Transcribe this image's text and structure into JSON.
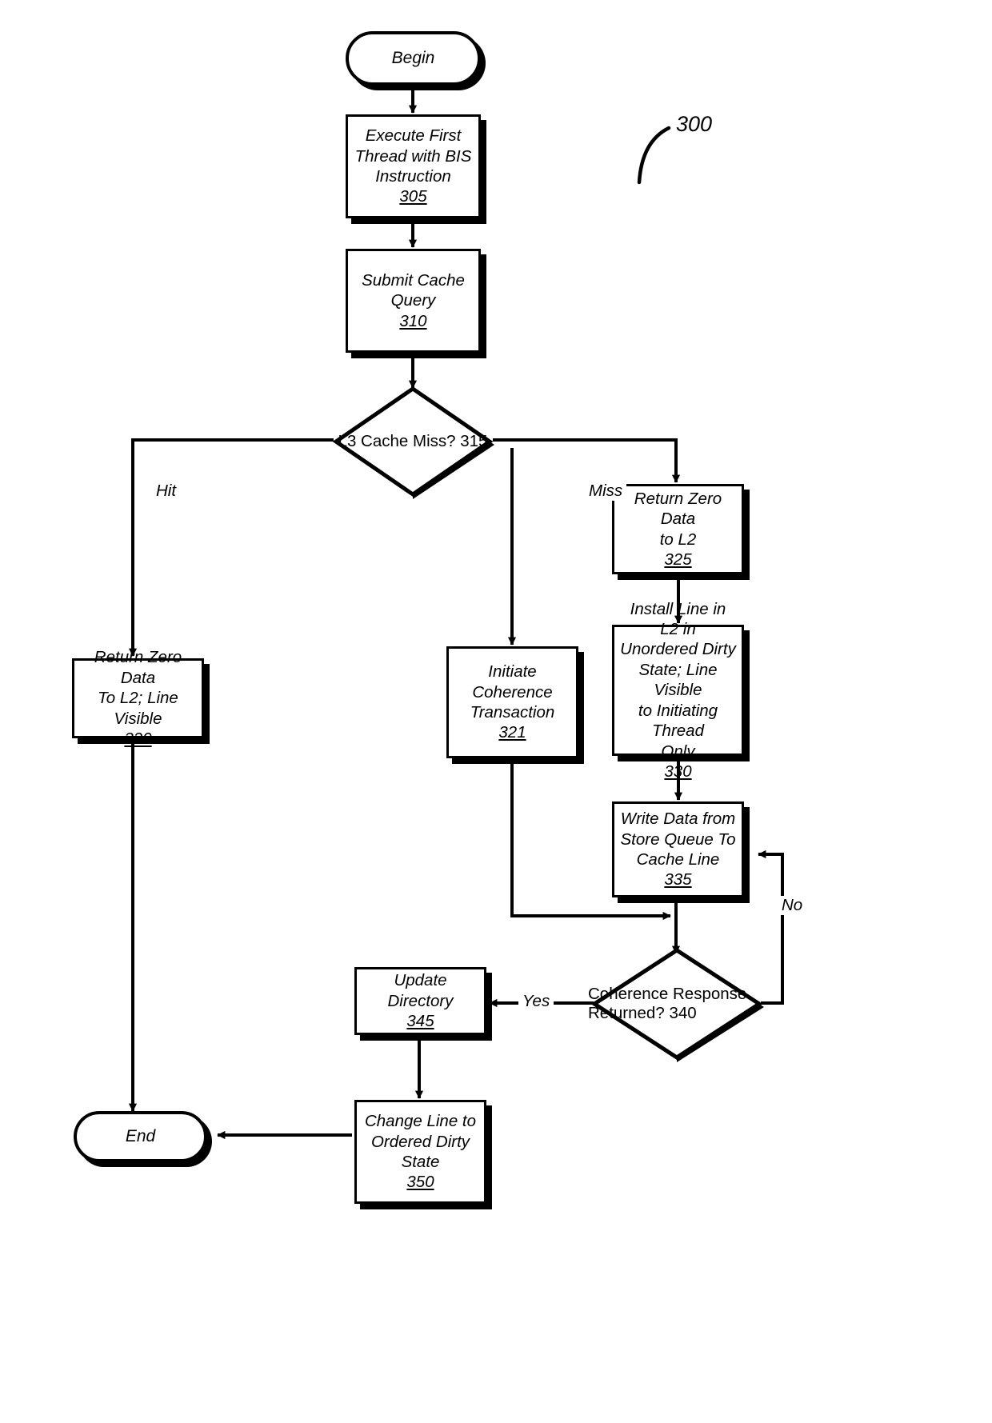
{
  "figure": {
    "reference_number": "300",
    "type": "flowchart"
  },
  "nodes": {
    "begin": {
      "label": "Begin"
    },
    "s305": {
      "label": "Execute First\nThread with BIS\nInstruction",
      "number": "305"
    },
    "s310": {
      "label": "Submit Cache\nQuery",
      "number": "310"
    },
    "d315": {
      "label": "L3\nCache Miss?",
      "number": "315"
    },
    "s320": {
      "label": "Return Zero Data\nTo L2; Line Visible",
      "number": "320"
    },
    "s321": {
      "label": "Initiate Coherence\nTransaction",
      "number": "321"
    },
    "s325": {
      "label": "Return Zero Data\nto L2",
      "number": "325"
    },
    "s330": {
      "label": "Install Line in L2 in\nUnordered Dirty\nState; Line Visible\nto Initiating Thread\nOnly",
      "number": "330"
    },
    "s335": {
      "label": "Write Data from\nStore Queue To\nCache Line",
      "number": "335"
    },
    "d340": {
      "label": "Coherence\nResponse Returned?",
      "number": "340"
    },
    "s345": {
      "label": "Update Directory",
      "number": "345"
    },
    "s350": {
      "label": "Change Line to\nOrdered Dirty\nState",
      "number": "350"
    },
    "end": {
      "label": "End"
    }
  },
  "edge_labels": {
    "hit": "Hit",
    "miss": "Miss",
    "yes": "Yes",
    "no": "No"
  },
  "colors": {
    "stroke": "#000000",
    "fill": "#ffffff",
    "shadow": "#000000"
  }
}
